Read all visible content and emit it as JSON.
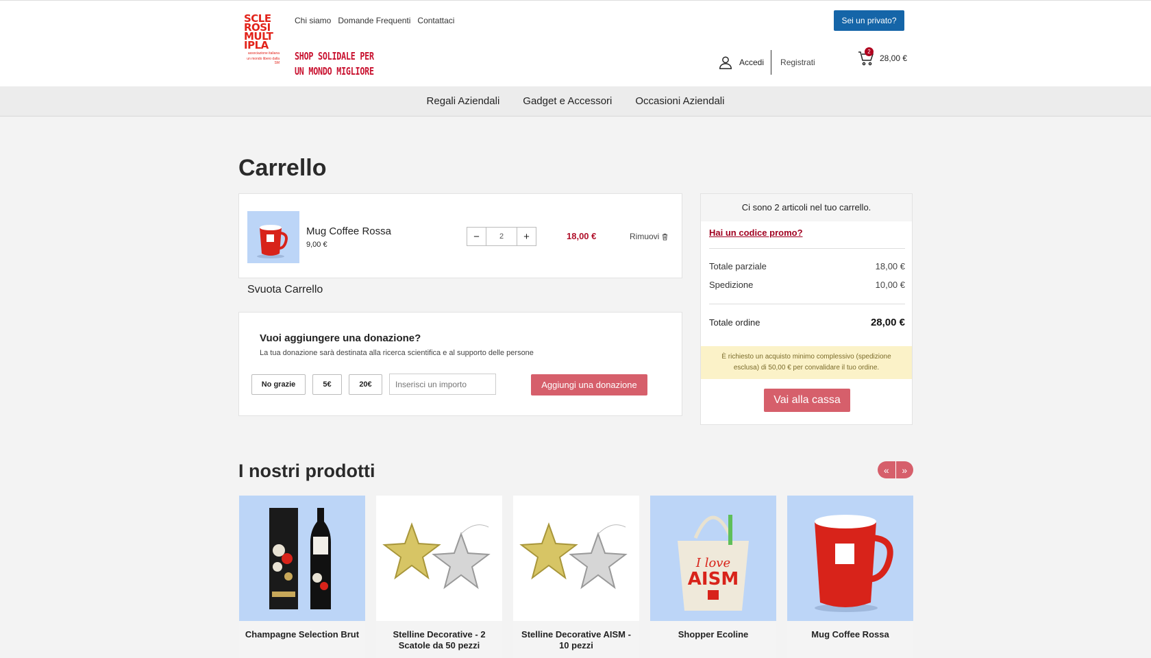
{
  "header": {
    "logo_lines": [
      "SCLE",
      "ROSI",
      "MULT",
      "IPLA"
    ],
    "logo_sub": "associazione italiana",
    "logo_tag": "un mondo libero dalla SM",
    "top_links": [
      "Chi siamo",
      "Domande Frequenti",
      "Contattaci"
    ],
    "tagline_line1": "SHOP SOLIDALE PER",
    "tagline_line2": "UN MONDO MIGLIORE",
    "private_button": "Sei un privato?",
    "login": "Accedi",
    "register": "Registrati",
    "cart_count": "2",
    "cart_total": "28,00 €"
  },
  "nav": [
    "Regali Aziendali",
    "Gadget e Accessori",
    "Occasioni Aziendali"
  ],
  "page_title": "Carrello",
  "cart_item": {
    "name": "Mug Coffee Rossa",
    "unit_price": "9,00 €",
    "quantity": "2",
    "total": "18,00 €",
    "remove": "Rimuovi"
  },
  "empty_cart": "Svuota Carrello",
  "donation": {
    "title": "Vuoi aggiungere una donazione?",
    "subtitle": "La tua donazione sarà destinata alla ricerca scientifica e al supporto delle persone",
    "options": [
      "No grazie",
      "5€",
      "20€"
    ],
    "input_placeholder": "Inserisci un importo",
    "add_button": "Aggiungi una donazione"
  },
  "summary": {
    "header": "Ci sono 2 articoli nel tuo carrello.",
    "promo": "Hai un codice promo?",
    "subtotal_label": "Totale parziale",
    "subtotal_value": "18,00 €",
    "shipping_label": "Spedizione",
    "shipping_value": "10,00 €",
    "total_label": "Totale ordine",
    "total_value": "28,00 €",
    "notice": "È richiesto un acquisto minimo complessivo (spedizione esclusa) di 50,00 € per convalidare il tuo ordine.",
    "checkout": "Vai alla cassa"
  },
  "products_title": "I nostri prodotti",
  "products": [
    {
      "name": "Champagne Selection Brut",
      "bg": "blue"
    },
    {
      "name": "Stelline Decorative - 2 Scatole da 50 pezzi",
      "bg": "white"
    },
    {
      "name": "Stelline Decorative AISM - 10 pezzi",
      "bg": "white"
    },
    {
      "name": "Shopper Ecoline",
      "bg": "blue"
    },
    {
      "name": "Mug Coffee Rossa",
      "bg": "blue"
    }
  ],
  "bag_text_1": "I love",
  "bag_text_2": "AISM",
  "colors": {
    "accent": "#d65f6b",
    "brand_red": "#c8102e",
    "primary_blue": "#1565a8",
    "product_bg": "#bcd5f7"
  }
}
